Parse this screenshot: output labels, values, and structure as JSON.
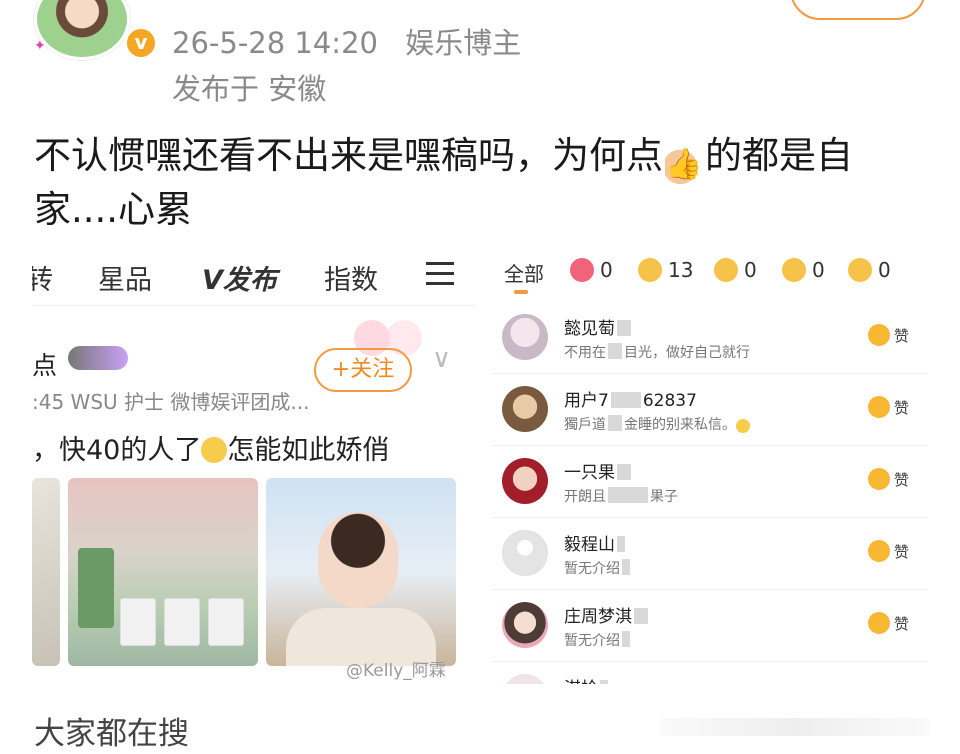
{
  "header": {
    "timestamp": "26-5-28 14:20",
    "author_tag": "娱乐博主",
    "location": "发布于 安徽",
    "verified_mark": "v"
  },
  "post": {
    "text_before": "不认惯嘿还看不出来是嘿稿吗，为何点",
    "text_after": "的都是自家....心累",
    "thumb_glyph": "👍"
  },
  "left_screenshot": {
    "tabs": [
      "转",
      "星品",
      "V发布",
      "指数"
    ],
    "author_name": "点",
    "follow_label": "+关注",
    "meta": ":45  WSU 护士  微博娱评团成...",
    "text_before": "，快40的人了",
    "text_after": "怎能如此娇俏",
    "watermark": "@Kelly_阿霖"
  },
  "right_screenshot": {
    "tabs": [
      {
        "label": "全部"
      },
      {
        "label": "0",
        "icon": "heart-icon"
      },
      {
        "label": "13",
        "icon": "thumbs-up-icon"
      },
      {
        "label": "0",
        "icon": "laugh-icon"
      },
      {
        "label": "0",
        "icon": "surprised-icon"
      },
      {
        "label": "0",
        "icon": "sad-icon"
      }
    ],
    "rows": [
      {
        "name": "懿见萄",
        "desc_a": "不用在",
        "desc_b": "目光，做好自己就行",
        "like": "赞"
      },
      {
        "name": "用户7",
        "name_b": "62837",
        "desc_a": "獨戶道",
        "desc_b": "金睡的别来私信。",
        "like": "赞"
      },
      {
        "name": "一只果",
        "desc_a": "开朗且",
        "desc_b": "果子",
        "like": "赞"
      },
      {
        "name": "毅程山",
        "desc_a": "暂无介绍",
        "desc_b": "",
        "like": "赞"
      },
      {
        "name": "庄周梦淇",
        "desc_a": "暂无介绍",
        "desc_b": "",
        "like": "赞"
      },
      {
        "name": "淇桧",
        "desc_a": "",
        "desc_b": "",
        "like": ""
      }
    ]
  },
  "footer": {
    "search_label": "大家都在搜"
  },
  "colors": {
    "accent": "#f39a3e",
    "meta_gray": "#8a8a8a"
  }
}
